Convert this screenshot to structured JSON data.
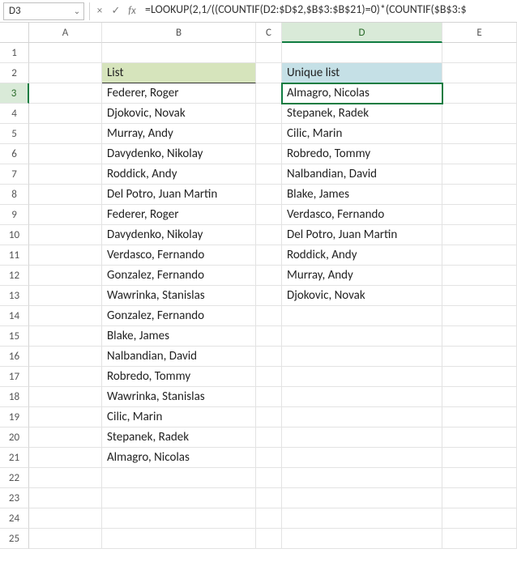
{
  "name_box": {
    "value": "D3"
  },
  "formula": "=LOOKUP(2,1/((COUNTIF(D2:$D$2,$B$3:$B$21)=0)*(COUNTIF($B$3:$",
  "fx_label": "fx",
  "icons": {
    "cancel": "×",
    "confirm": "✓",
    "dropdown": "⌄"
  },
  "columns": [
    "A",
    "B",
    "C",
    "D",
    "E"
  ],
  "row_count": 25,
  "active_cell": {
    "row": 3,
    "col": "D"
  },
  "headers": {
    "list": "List",
    "unique": "Unique list"
  },
  "list": [
    "Federer, Roger",
    "Djokovic, Novak",
    "Murray, Andy",
    "Davydenko, Nikolay",
    "Roddick, Andy",
    "Del Potro, Juan Martin",
    "Federer, Roger",
    "Davydenko, Nikolay",
    "Verdasco, Fernando",
    "Gonzalez, Fernando",
    "Wawrinka, Stanislas",
    "Gonzalez, Fernando",
    "Blake, James",
    "Nalbandian, David",
    "Robredo, Tommy",
    "Wawrinka, Stanislas",
    "Cilic, Marin",
    "Stepanek, Radek",
    "Almagro, Nicolas"
  ],
  "unique": [
    "Almagro, Nicolas",
    "Stepanek, Radek",
    "Cilic, Marin",
    "Robredo, Tommy",
    "Nalbandian, David",
    "Blake, James",
    "Verdasco, Fernando",
    "Del Potro, Juan Martin",
    "Roddick, Andy",
    "Murray, Andy",
    "Djokovic, Novak"
  ]
}
